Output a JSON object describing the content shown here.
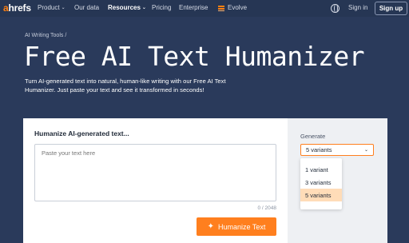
{
  "nav": {
    "logo_a": "a",
    "logo_rest": "hrefs",
    "items": [
      {
        "label": "Product",
        "has_dropdown": true
      },
      {
        "label": "Our data",
        "has_dropdown": false
      },
      {
        "label": "Resources",
        "has_dropdown": true,
        "active": true
      },
      {
        "label": "Pricing",
        "has_dropdown": false
      },
      {
        "label": "Enterprise",
        "has_dropdown": false
      },
      {
        "label": "Evolve",
        "has_dropdown": false
      }
    ],
    "sign_in": "Sign in",
    "sign_up": "Sign up",
    "chevron": "⌄"
  },
  "hero": {
    "breadcrumb": "AI Writing Tools /",
    "title": "Free AI Text Humanizer",
    "description": "Turn AI-generated text into natural, human-like writing with our Free AI Text Humanizer. Just paste your text and see it transformed in seconds!"
  },
  "tool": {
    "input_label": "Humanize AI-generated text...",
    "placeholder": "Paste your text here",
    "counter": "0 / 2048",
    "button_label": "Humanize Text",
    "sparkle": "✦",
    "generate_label": "Generate",
    "selected_variant": "5 variants",
    "options": [
      "1 variant",
      "3 variants",
      "5 variants"
    ]
  },
  "colors": {
    "background": "#2a3a5b",
    "accent": "#ff7f1e",
    "selected_option": "#ffdcb8"
  }
}
